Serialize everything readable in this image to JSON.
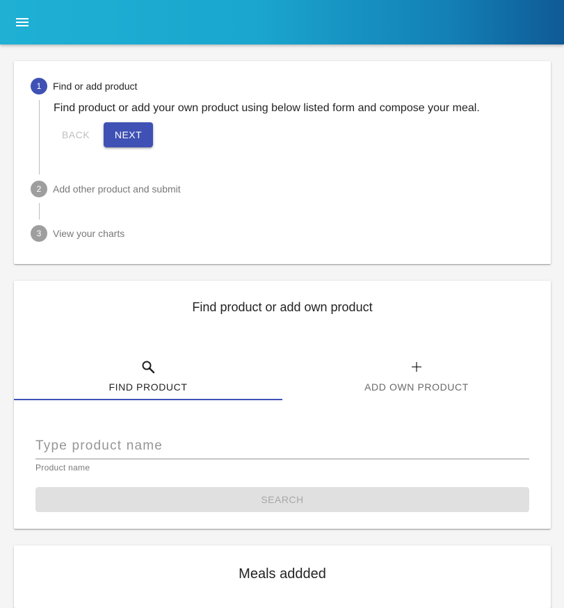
{
  "appbar": {
    "menu_icon": "menu-icon"
  },
  "stepper": {
    "steps": [
      {
        "number": "1",
        "label": "Find or add product",
        "state": "active"
      },
      {
        "number": "2",
        "label": "Add other product and submit",
        "state": "inactive"
      },
      {
        "number": "3",
        "label": "View your charts",
        "state": "inactive"
      }
    ],
    "active_description": "Find product or add your own product using below listed form and compose your meal.",
    "back_label": "BACK",
    "next_label": "NEXT"
  },
  "finder": {
    "title": "Find product or add own product",
    "tabs": [
      {
        "label": "FIND PRODUCT",
        "icon": "search-icon",
        "selected": true
      },
      {
        "label": "ADD OWN PRODUCT",
        "icon": "plus-icon",
        "selected": false
      }
    ],
    "input": {
      "placeholder": "Type product name",
      "value": ""
    },
    "helper_text": "Product name",
    "search_label": "SEARCH"
  },
  "meals": {
    "title": "Meals addded"
  },
  "colors": {
    "primary": "#3f51b5",
    "appbar_start": "#1fb0d4",
    "appbar_end": "#0f5a95"
  }
}
